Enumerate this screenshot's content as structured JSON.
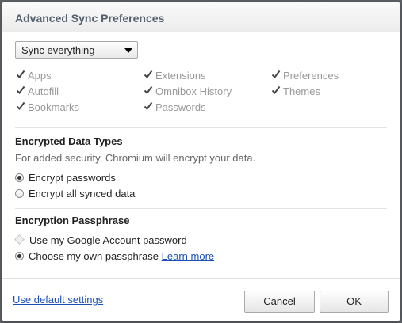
{
  "dialog": {
    "title": "Advanced Sync Preferences"
  },
  "sync_select": {
    "value": "Sync everything"
  },
  "data_types": [
    {
      "label": "Apps",
      "checked": true
    },
    {
      "label": "Autofill",
      "checked": true
    },
    {
      "label": "Bookmarks",
      "checked": true
    },
    {
      "label": "Extensions",
      "checked": true
    },
    {
      "label": "Omnibox History",
      "checked": true
    },
    {
      "label": "Passwords",
      "checked": true
    },
    {
      "label": "Preferences",
      "checked": true
    },
    {
      "label": "Themes",
      "checked": true
    }
  ],
  "encrypted": {
    "heading": "Encrypted Data Types",
    "description": "For added security, Chromium will encrypt your data.",
    "option_passwords": "Encrypt passwords",
    "option_all": "Encrypt all synced data"
  },
  "passphrase": {
    "heading": "Encryption Passphrase",
    "option_google": "Use my Google Account password",
    "option_own": "Choose my own passphrase",
    "learn_more": "Learn more"
  },
  "footer": {
    "default_link": "Use default settings",
    "cancel_label": "Cancel",
    "ok_label": "OK"
  },
  "colors": {
    "title": "#55606f",
    "link": "#1a4fb8",
    "disabled_text": "#999999"
  }
}
